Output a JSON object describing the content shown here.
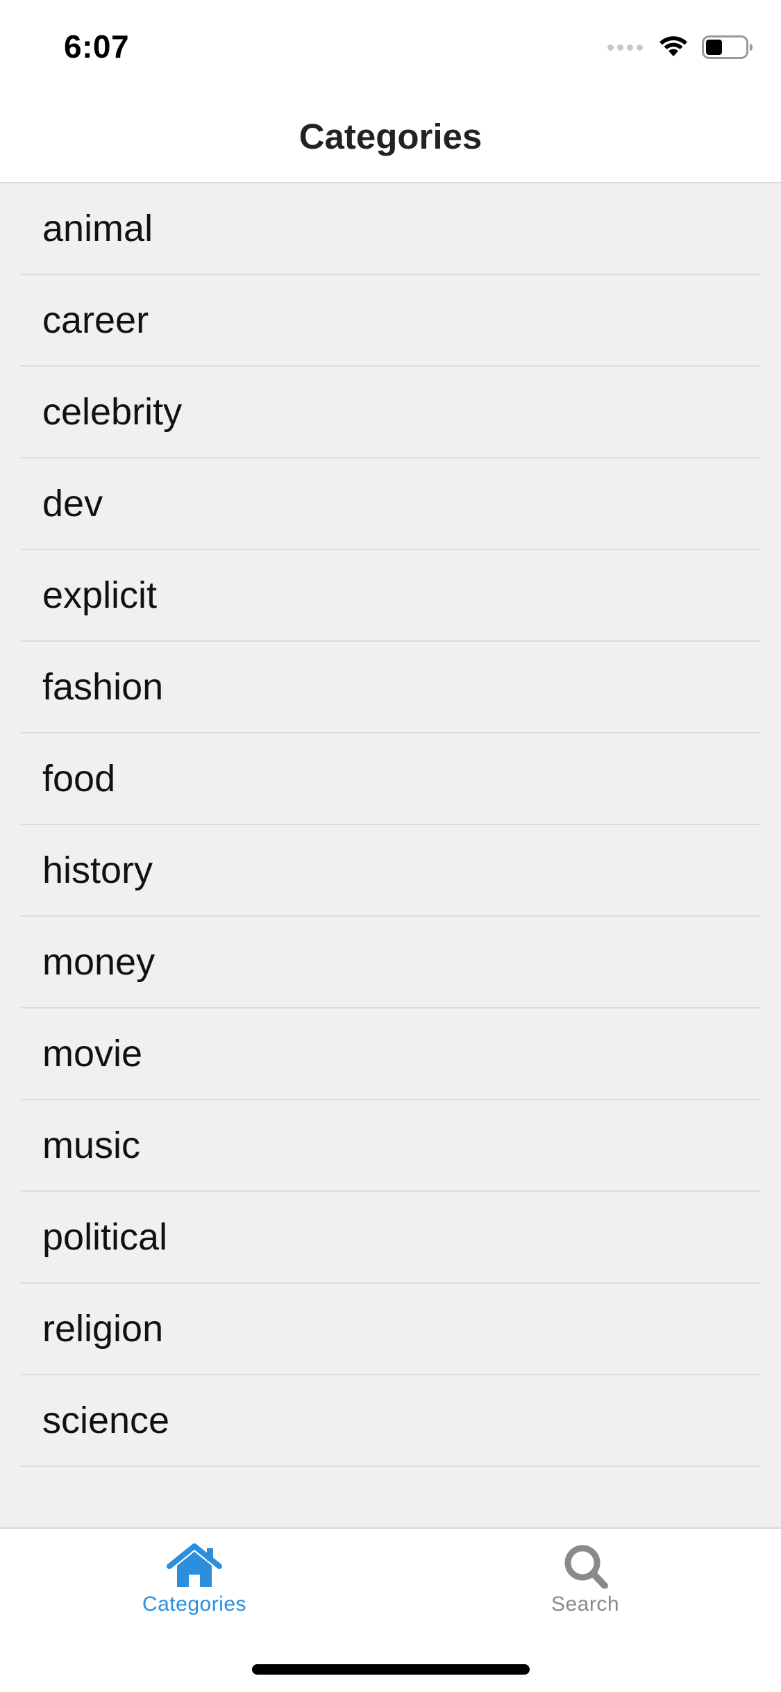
{
  "status_bar": {
    "time": "6:07",
    "icons": [
      "cellular-signal-icon",
      "wifi-icon",
      "battery-icon"
    ]
  },
  "nav": {
    "title": "Categories"
  },
  "categories": [
    "animal",
    "career",
    "celebrity",
    "dev",
    "explicit",
    "fashion",
    "food",
    "history",
    "money",
    "movie",
    "music",
    "political",
    "religion",
    "science"
  ],
  "tab_bar": {
    "tabs": [
      {
        "label": "Categories",
        "icon": "home-icon",
        "active": true
      },
      {
        "label": "Search",
        "icon": "search-icon",
        "active": false
      }
    ],
    "active_color": "#2b8fde",
    "inactive_color": "#8a8a8a"
  },
  "colors": {
    "list_background": "#f0f0f0",
    "separator": "#dcdcdc"
  }
}
